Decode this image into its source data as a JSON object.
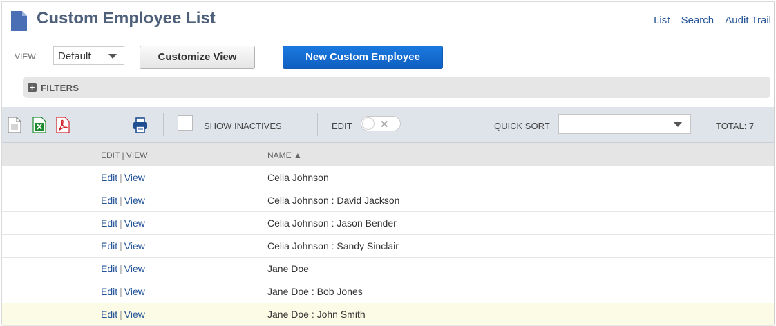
{
  "header": {
    "title": "Custom Employee List",
    "links": [
      "List",
      "Search",
      "Audit Trail"
    ]
  },
  "view_bar": {
    "view_label": "VIEW",
    "view_value": "Default",
    "customize_label": "Customize View",
    "new_label": "New Custom Employee"
  },
  "filters": {
    "label": "FILTERS"
  },
  "toolbar": {
    "show_inactives": "SHOW INACTIVES",
    "edit_label": "EDIT",
    "quick_sort_label": "QUICK SORT",
    "quick_sort_value": "",
    "total": "TOTAL: 7",
    "colors": {
      "csv": "#808080",
      "excel": "#1d8a2e",
      "pdf": "#d2232a",
      "print": "#1f4f91"
    }
  },
  "table": {
    "headers": [
      "EDIT | VIEW",
      "NAME ▲"
    ],
    "rows": [
      {
        "edit": "Edit",
        "view": "View",
        "name": "Celia Johnson"
      },
      {
        "edit": "Edit",
        "view": "View",
        "name": "Celia Johnson : David Jackson"
      },
      {
        "edit": "Edit",
        "view": "View",
        "name": "Celia Johnson : Jason Bender"
      },
      {
        "edit": "Edit",
        "view": "View",
        "name": "Celia Johnson : Sandy Sinclair"
      },
      {
        "edit": "Edit",
        "view": "View",
        "name": "Jane Doe"
      },
      {
        "edit": "Edit",
        "view": "View",
        "name": "Jane Doe : Bob Jones"
      },
      {
        "edit": "Edit",
        "view": "View",
        "name": "Jane Doe : John Smith"
      }
    ]
  }
}
